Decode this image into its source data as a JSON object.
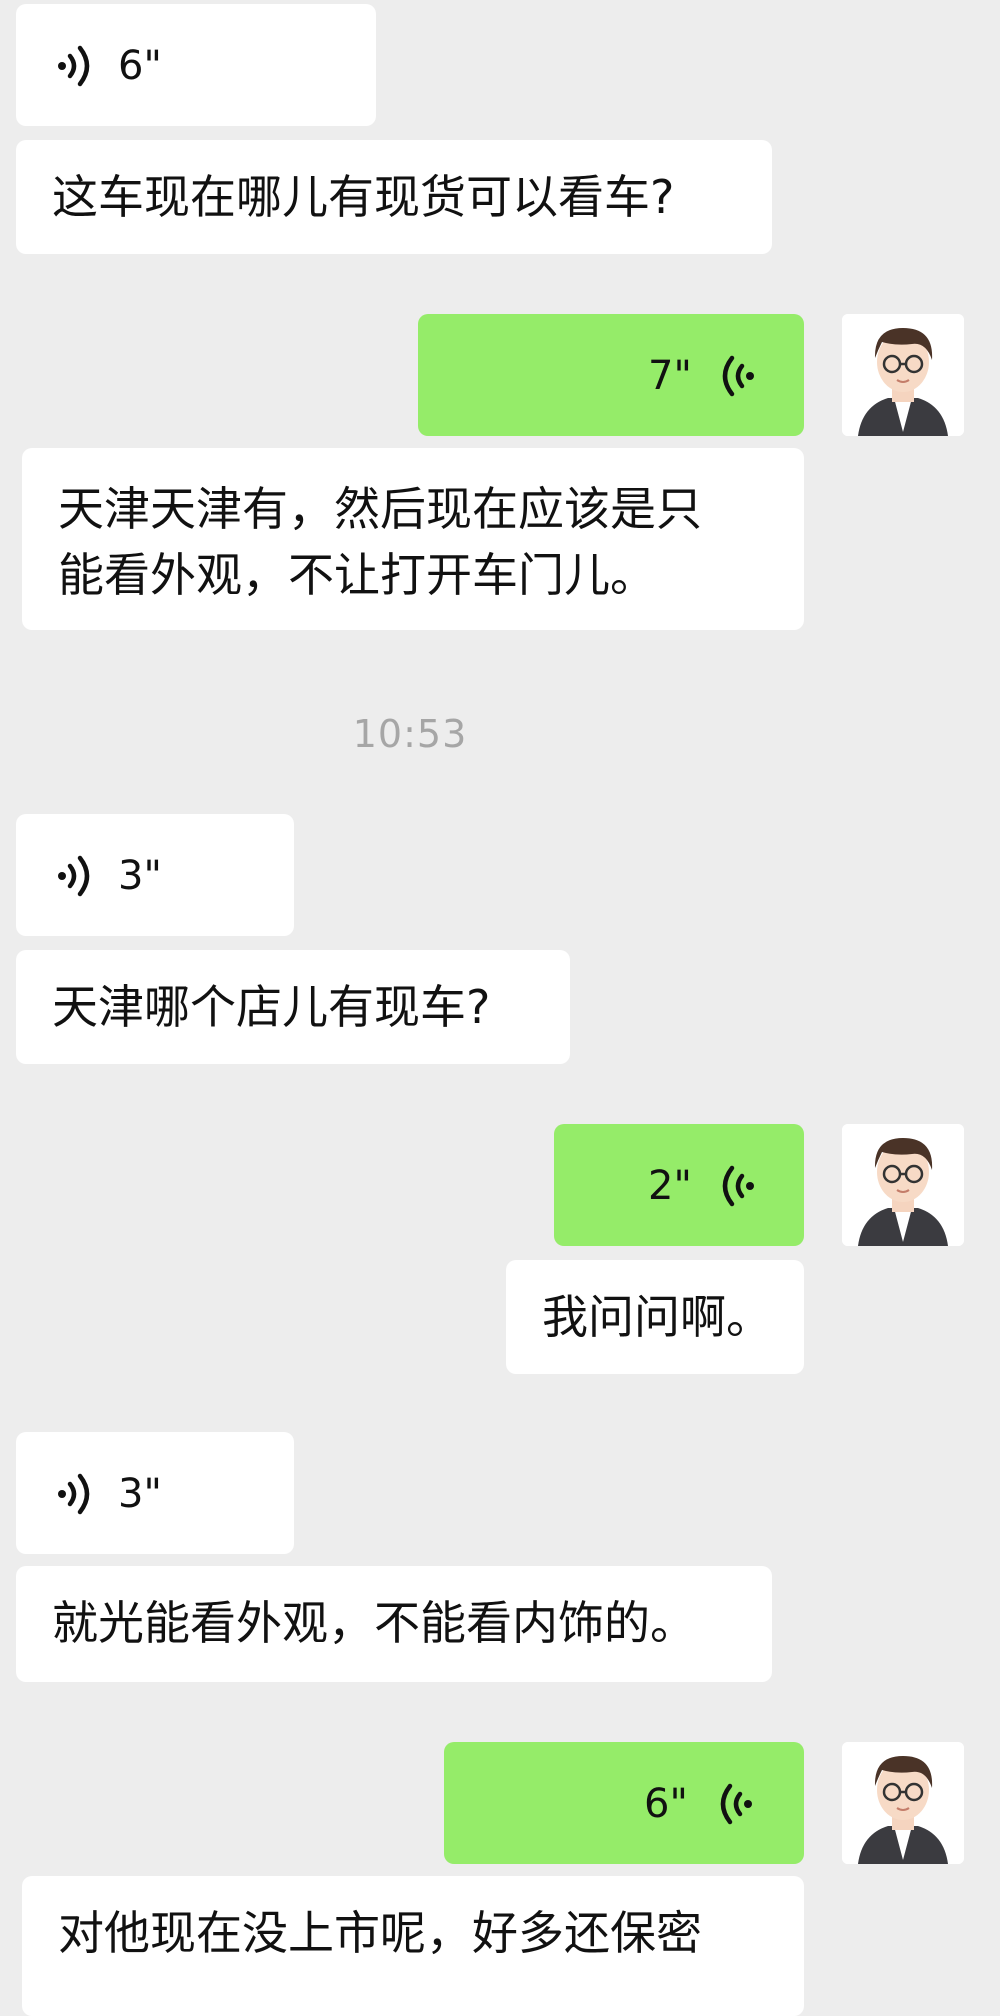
{
  "messages": [
    {
      "type": "voice",
      "side": "left",
      "duration": "6\""
    },
    {
      "type": "text",
      "side": "left",
      "text": "这车现在哪儿有现货可以看车?"
    },
    {
      "type": "voice",
      "side": "right",
      "duration": "7\""
    },
    {
      "type": "text",
      "side": "left",
      "lines": [
        "天津天津有，然后现在应该是只",
        "能看外观，不让打开车门儿。"
      ]
    },
    {
      "type": "timestamp",
      "text": "10:53"
    },
    {
      "type": "voice",
      "side": "left",
      "duration": "3\""
    },
    {
      "type": "text",
      "side": "left",
      "text": "天津哪个店儿有现车?"
    },
    {
      "type": "voice",
      "side": "right",
      "duration": "2\""
    },
    {
      "type": "text",
      "side": "right",
      "text": "我问问啊。"
    },
    {
      "type": "voice",
      "side": "left",
      "duration": "3\""
    },
    {
      "type": "text",
      "side": "left",
      "text": "就光能看外观，不能看内饰的。"
    },
    {
      "type": "voice",
      "side": "right",
      "duration": "6\""
    },
    {
      "type": "text",
      "side": "left",
      "text": "对他现在没上市呢，好多还保密"
    }
  ],
  "colors": {
    "background": "#ededed",
    "incoming_bubble": "#ffffff",
    "outgoing_bubble": "#95ec69",
    "timestamp": "#a6a6a6"
  },
  "icons": {
    "voice_incoming": "voice-wave-icon",
    "voice_outgoing": "voice-wave-icon",
    "avatar": "cartoon-man-with-glasses-avatar"
  }
}
